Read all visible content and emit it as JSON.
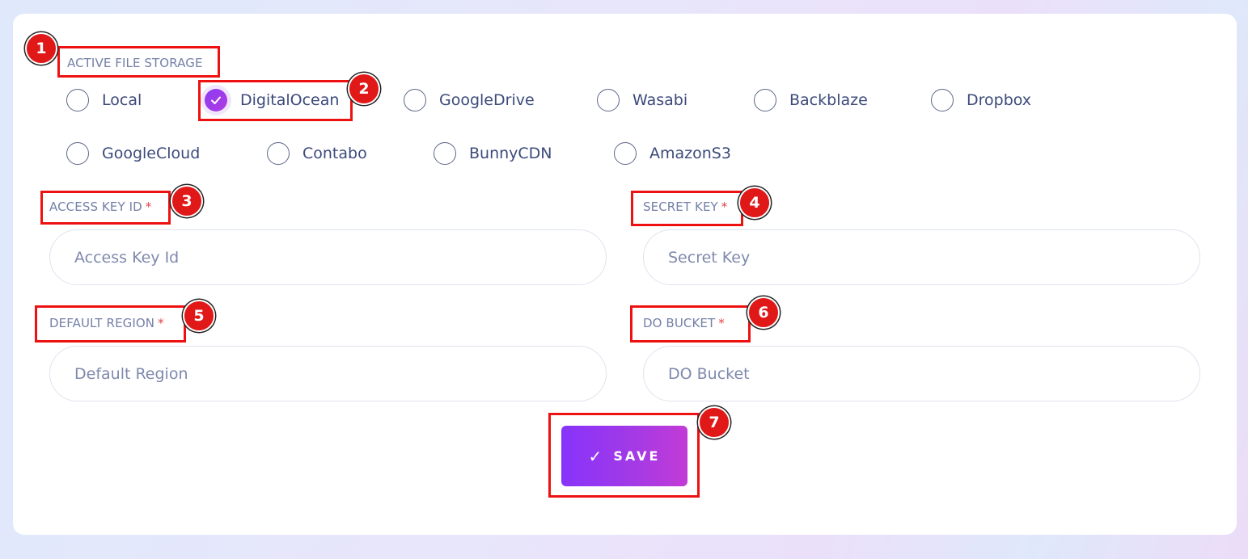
{
  "storage": {
    "label": "ACTIVE FILE STORAGE",
    "selected": "DigitalOcean",
    "options": [
      "Local",
      "DigitalOcean",
      "GoogleDrive",
      "Wasabi",
      "Backblaze",
      "Dropbox",
      "GoogleCloud",
      "Contabo",
      "BunnyCDN",
      "AmazonS3"
    ]
  },
  "fields": {
    "access_key": {
      "label": "ACCESS KEY ID",
      "required_mark": "*",
      "placeholder": "Access Key Id",
      "value": ""
    },
    "secret_key": {
      "label": "SECRET KEY",
      "required_mark": "*",
      "placeholder": "Secret Key",
      "value": ""
    },
    "region": {
      "label": "DEFAULT REGION",
      "required_mark": "*",
      "placeholder": "Default Region",
      "value": ""
    },
    "bucket": {
      "label": "DO BUCKET",
      "required_mark": "*",
      "placeholder": "DO Bucket",
      "value": ""
    }
  },
  "save_button": {
    "icon": "check-icon",
    "glyph": "✓",
    "label": "SAVE"
  },
  "annotations": [
    "1",
    "2",
    "3",
    "4",
    "5",
    "6",
    "7"
  ],
  "colors": {
    "accent_start": "#8733fb",
    "accent_end": "#c23bd6",
    "annotation": "#ee1111",
    "required": "#e2404a"
  }
}
